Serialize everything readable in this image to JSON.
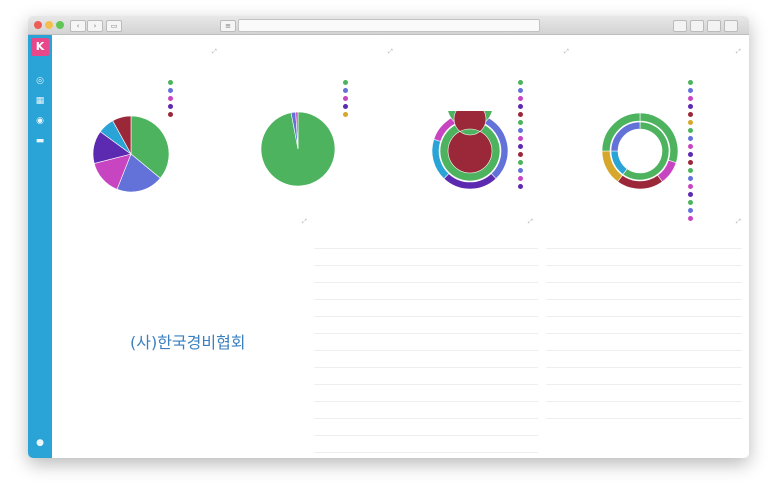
{
  "browser": {
    "url": "",
    "dots": [
      "#ec5f57",
      "#f5bf4f",
      "#62c655"
    ]
  },
  "sidebar": {
    "logo_letter": "K",
    "icons": [
      "discover-icon",
      "visualize-icon",
      "dashboard-icon",
      "settings-icon",
      "help-icon"
    ]
  },
  "breadcrumb": "",
  "panels": {
    "p1": {
      "title": "",
      "legend": [
        {
          "label": "",
          "color": "#4db35e"
        },
        {
          "label": "",
          "color": "#6272d8"
        },
        {
          "label": "",
          "color": "#c845c2"
        },
        {
          "label": "",
          "color": "#5b2ab0"
        },
        {
          "label": "",
          "color": "#9b2838"
        }
      ]
    },
    "p2": {
      "title": "",
      "legend": [
        {
          "label": "",
          "color": "#4db35e"
        },
        {
          "label": "",
          "color": "#6272d8"
        },
        {
          "label": "",
          "color": "#c845c2"
        },
        {
          "label": "",
          "color": "#5b2ab0"
        },
        {
          "label": "",
          "color": "#d6a72a"
        }
      ]
    },
    "p3": {
      "title": "",
      "legend": [
        {
          "label": "",
          "color": "#4db35e"
        },
        {
          "label": "",
          "color": "#6272d8"
        },
        {
          "label": "",
          "color": "#c845c2"
        },
        {
          "label": "",
          "color": "#5b2ab0"
        },
        {
          "label": "",
          "color": "#9b2838"
        },
        {
          "label": "",
          "color": "#4db35e"
        },
        {
          "label": "",
          "color": "#6272d8"
        },
        {
          "label": "",
          "color": "#c845c2"
        },
        {
          "label": "",
          "color": "#5b2ab0"
        },
        {
          "label": "",
          "color": "#9b2838"
        },
        {
          "label": "",
          "color": "#4db35e"
        },
        {
          "label": "",
          "color": "#6272d8"
        },
        {
          "label": "",
          "color": "#c845c2"
        },
        {
          "label": "",
          "color": "#5b2ab0"
        }
      ]
    },
    "p4": {
      "title": "",
      "legend": [
        {
          "label": "",
          "color": "#4db35e"
        },
        {
          "label": "",
          "color": "#6272d8"
        },
        {
          "label": "",
          "color": "#c845c2"
        },
        {
          "label": "",
          "color": "#5b2ab0"
        },
        {
          "label": "",
          "color": "#9b2838"
        },
        {
          "label": "",
          "color": "#d6a72a"
        },
        {
          "label": "",
          "color": "#4db35e"
        },
        {
          "label": "",
          "color": "#6272d8"
        },
        {
          "label": "",
          "color": "#c845c2"
        },
        {
          "label": "",
          "color": "#5b2ab0"
        },
        {
          "label": "",
          "color": "#9b2838"
        },
        {
          "label": "",
          "color": "#4db35e"
        },
        {
          "label": "",
          "color": "#6272d8"
        },
        {
          "label": "",
          "color": "#c845c2"
        },
        {
          "label": "",
          "color": "#5b2ab0"
        },
        {
          "label": "",
          "color": "#4db35e"
        },
        {
          "label": "",
          "color": "#6272d8"
        },
        {
          "label": "",
          "color": "#c845c2"
        }
      ]
    },
    "p5": {
      "title": ""
    },
    "p6": {
      "title": ""
    },
    "p7": {
      "title": ""
    }
  },
  "tag_cloud": {
    "main": "(사)한국경비협회",
    "main_color": "#3b7fbf",
    "small": [
      {
        "text": "",
        "color": "#4db35e"
      },
      {
        "text": "",
        "color": "#6272d8"
      },
      {
        "text": "",
        "color": "#c845c2"
      },
      {
        "text": "",
        "color": "#5b2ab0"
      },
      {
        "text": "",
        "color": "#2aa3d6"
      },
      {
        "text": "",
        "color": "#d6a72a"
      },
      {
        "text": "",
        "color": "#9b2838"
      },
      {
        "text": "",
        "color": "#4db35e"
      }
    ]
  },
  "table_mid": {
    "headers": [
      "",
      "",
      ""
    ],
    "rows": [
      {
        "c1": "",
        "c2": "",
        "c3": ""
      },
      {
        "c1": "",
        "c2": "",
        "c3": ""
      },
      {
        "c1": "",
        "c2": "",
        "c3": ""
      },
      {
        "c1": "",
        "c2": "",
        "c3": ""
      },
      {
        "c1": "",
        "c2": "",
        "c3": ""
      },
      {
        "c1": "",
        "c2": "",
        "c3": ""
      },
      {
        "c1": "",
        "c2": "",
        "c3": ""
      },
      {
        "c1": "",
        "c2": "",
        "c3": ""
      },
      {
        "c1": "",
        "c2": "",
        "c3": ""
      },
      {
        "c1": "",
        "c2": "",
        "c3": ""
      },
      {
        "c1": "",
        "c2": "",
        "c3": ""
      },
      {
        "c1": "",
        "c2": "",
        "c3": ""
      },
      {
        "c1": "",
        "c2": "",
        "c3": ""
      }
    ]
  },
  "table_right": {
    "headers": [
      "",
      "",
      ""
    ],
    "rows": [
      {
        "c1": "",
        "c2": "",
        "c3": ""
      },
      {
        "c1": "",
        "c2": "",
        "c3": ""
      },
      {
        "c1": "",
        "c2": "",
        "c3": ""
      },
      {
        "c1": "",
        "c2": "",
        "c3": ""
      },
      {
        "c1": "",
        "c2": "",
        "c3": ""
      },
      {
        "c1": "",
        "c2": "",
        "c3": ""
      },
      {
        "c1": "",
        "c2": "",
        "c3": ""
      },
      {
        "c1": "",
        "c2": "",
        "c3": ""
      },
      {
        "c1": "",
        "c2": "",
        "c3": ""
      },
      {
        "c1": "",
        "c2": "",
        "c3": ""
      }
    ],
    "footer": {
      "prefix": "",
      "link1": "",
      "link2": ""
    }
  },
  "chart_data": [
    {
      "type": "pie",
      "title": "",
      "values": [
        36,
        20,
        15,
        14,
        7,
        8
      ],
      "colors": [
        "#4db35e",
        "#6272d8",
        "#c845c2",
        "#5b2ab0",
        "#2aa3d6",
        "#9b2838"
      ]
    },
    {
      "type": "pie",
      "title": "",
      "values": [
        97,
        2,
        1
      ],
      "colors": [
        "#4db35e",
        "#6272d8",
        "#c845c2"
      ]
    },
    {
      "type": "pie",
      "title": "",
      "rings": [
        {
          "values": [
            38,
            24,
            18,
            20
          ],
          "colors": [
            "#6272d8",
            "#5b2ab0",
            "#2aa3d6",
            "#c845c2"
          ]
        },
        {
          "values": [
            100
          ],
          "colors": [
            "#4db35e"
          ]
        },
        {
          "values": [
            100
          ],
          "colors": [
            "#9b2838"
          ]
        }
      ]
    },
    {
      "type": "pie",
      "title": "",
      "rings": [
        {
          "values": [
            30,
            10,
            20,
            15,
            25
          ],
          "colors": [
            "#4db35e",
            "#c845c2",
            "#9b2838",
            "#d6a72a",
            "#4db35e"
          ]
        },
        {
          "values": [
            60,
            15,
            25
          ],
          "colors": [
            "#4db35e",
            "#2aa3d6",
            "#6272d8"
          ]
        }
      ]
    }
  ]
}
